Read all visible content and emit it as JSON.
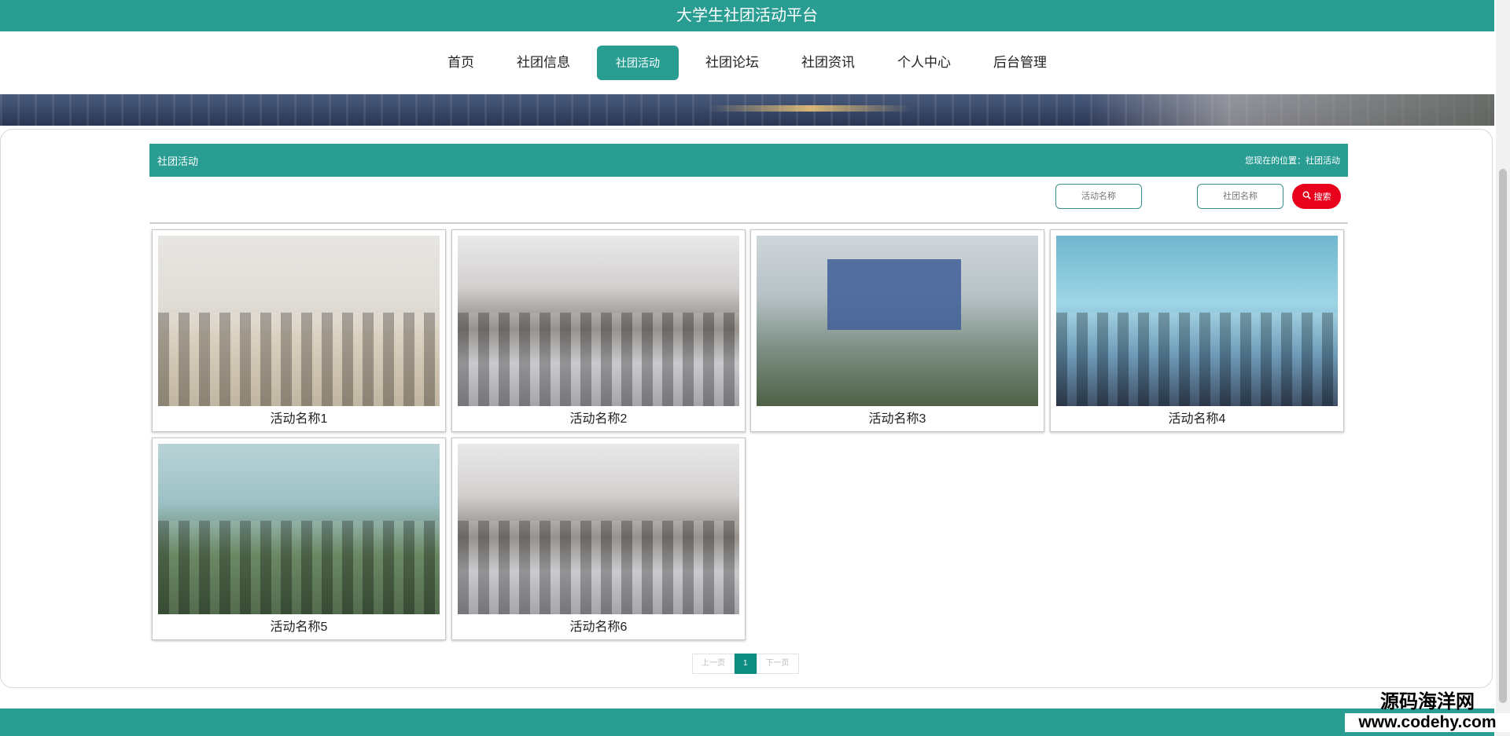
{
  "site_title": "大学生社团活动平台",
  "nav": {
    "items": [
      {
        "label": "首页"
      },
      {
        "label": "社团信息"
      },
      {
        "label": "社团活动",
        "active": true
      },
      {
        "label": "社团论坛"
      },
      {
        "label": "社团资讯"
      },
      {
        "label": "个人中心"
      },
      {
        "label": "后台管理"
      }
    ]
  },
  "section": {
    "title": "社团活动",
    "breadcrumb": "您现在的位置：社团活动"
  },
  "search": {
    "activity_name_placeholder": "活动名称",
    "club_name_placeholder": "社团名称",
    "button_label": "搜索"
  },
  "activities": [
    {
      "name": "活动名称1"
    },
    {
      "name": "活动名称2"
    },
    {
      "name": "活动名称3"
    },
    {
      "name": "活动名称4"
    },
    {
      "name": "活动名称5"
    },
    {
      "name": "活动名称6"
    }
  ],
  "pagination": {
    "prev_label": "上一页",
    "current_page": "1",
    "next_label": "下一页"
  },
  "watermark": {
    "line1": "源码海洋网",
    "line2": "www.codehy.com"
  },
  "colors": {
    "brand": "#2a9d93",
    "search_button": "#e8001c"
  },
  "icons": {
    "search_button_icon": "search-icon"
  }
}
